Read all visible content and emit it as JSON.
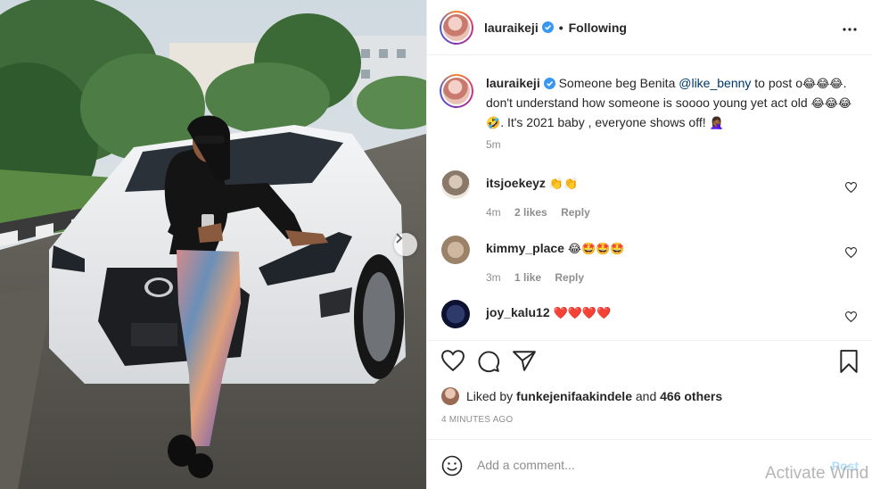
{
  "header": {
    "username": "lauraikeji",
    "separator": "•",
    "follow_status": "Following",
    "more_icon": "more-horizontal-icon"
  },
  "caption": {
    "username": "lauraikeji",
    "text_1": "Someone beg Benita ",
    "mention": "@like_benny",
    "text_2": " to post o",
    "emoji_1": "😂😂😂",
    "text_3": ". don't understand how someone is soooo young yet act old ",
    "emoji_2": "😂😂😂🤣",
    "text_4": ". It's 2021 baby , everyone shows off! ",
    "emoji_3": "🤦🏾‍♀️",
    "time": "5m"
  },
  "comments": [
    {
      "username": "itsjoekeyz",
      "text": "👏👏",
      "time": "4m",
      "likes": "2 likes",
      "reply": "Reply"
    },
    {
      "username": "kimmy_place",
      "text": "😂🤩🤩🤩",
      "time": "3m",
      "likes": "1 like",
      "reply": "Reply"
    },
    {
      "username": "joy_kalu12",
      "text": "❤️❤️❤️❤️"
    }
  ],
  "likes": {
    "prefix": "Liked by ",
    "user": "funkejenifaakindele",
    "and": " and ",
    "others": "466 others"
  },
  "timestamp": "4 MINUTES AGO",
  "add_comment": {
    "placeholder": "Add a comment...",
    "post_label": "Post"
  },
  "watermark": "Activate Wind",
  "colors": {
    "accent": "#0095f6",
    "verified": "#3897f0",
    "heart_red": "#ed4956",
    "muted": "#8e8e8e"
  }
}
